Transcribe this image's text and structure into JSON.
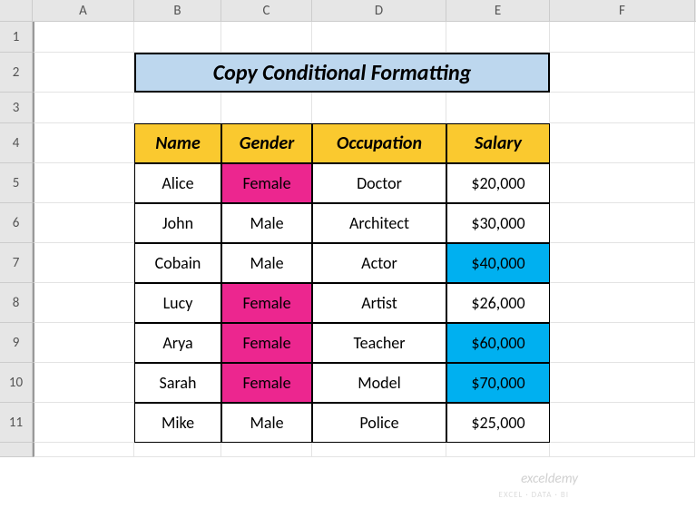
{
  "columns": [
    "A",
    "B",
    "C",
    "D",
    "E",
    "F"
  ],
  "rows": [
    "1",
    "2",
    "3",
    "4",
    "5",
    "6",
    "7",
    "8",
    "9",
    "10",
    "11"
  ],
  "title": "Copy Conditional Formatting",
  "headers": {
    "name": "Name",
    "gender": "Gender",
    "occupation": "Occupation",
    "salary": "Salary"
  },
  "data": [
    {
      "name": "Alice",
      "gender": "Female",
      "occupation": "Doctor",
      "salary": "$20,000",
      "gender_hl": true,
      "salary_hl": false
    },
    {
      "name": "John",
      "gender": "Male",
      "occupation": "Architect",
      "salary": "$30,000",
      "gender_hl": false,
      "salary_hl": false
    },
    {
      "name": "Cobain",
      "gender": "Male",
      "occupation": "Actor",
      "salary": "$40,000",
      "gender_hl": false,
      "salary_hl": true
    },
    {
      "name": "Lucy",
      "gender": "Female",
      "occupation": "Artist",
      "salary": "$26,000",
      "gender_hl": true,
      "salary_hl": false
    },
    {
      "name": "Arya",
      "gender": "Female",
      "occupation": "Teacher",
      "salary": "$60,000",
      "gender_hl": true,
      "salary_hl": true
    },
    {
      "name": "Sarah",
      "gender": "Female",
      "occupation": "Model",
      "salary": "$70,000",
      "gender_hl": true,
      "salary_hl": true
    },
    {
      "name": "Mike",
      "gender": "Male",
      "occupation": "Police",
      "salary": "$25,000",
      "gender_hl": false,
      "salary_hl": false
    }
  ],
  "watermark": "exceldemy",
  "watermark_sub": "EXCEL · DATA · BI",
  "chart_data": {
    "type": "table",
    "title": "Copy Conditional Formatting",
    "columns": [
      "Name",
      "Gender",
      "Occupation",
      "Salary"
    ],
    "rows": [
      [
        "Alice",
        "Female",
        "Doctor",
        20000
      ],
      [
        "John",
        "Male",
        "Architect",
        30000
      ],
      [
        "Cobain",
        "Male",
        "Actor",
        40000
      ],
      [
        "Lucy",
        "Female",
        "Artist",
        26000
      ],
      [
        "Arya",
        "Female",
        "Teacher",
        60000
      ],
      [
        "Sarah",
        "Female",
        "Model",
        70000
      ],
      [
        "Mike",
        "Male",
        "Police",
        25000
      ]
    ],
    "conditional_formatting": {
      "gender_pink_if": "Female",
      "salary_blue_if_gte": 40000
    }
  }
}
